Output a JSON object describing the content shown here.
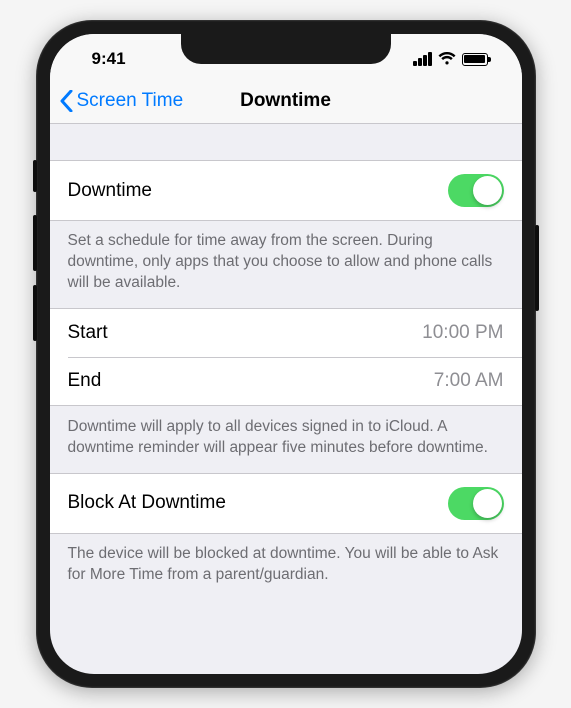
{
  "status": {
    "time": "9:41"
  },
  "nav": {
    "back_label": "Screen Time",
    "title": "Downtime"
  },
  "downtime_toggle": {
    "label": "Downtime",
    "on": true
  },
  "downtime_footer": "Set a schedule for time away from the screen. During downtime, only apps that you choose to allow and phone calls will be available.",
  "schedule": {
    "start_label": "Start",
    "start_value": "10:00 PM",
    "end_label": "End",
    "end_value": "7:00 AM"
  },
  "schedule_footer": "Downtime will apply to all devices signed in to iCloud. A downtime reminder will appear five minutes before downtime.",
  "block_toggle": {
    "label": "Block At Downtime",
    "on": true
  },
  "block_footer": "The device will be blocked at downtime. You will be able to Ask for More Time from a parent/guardian.",
  "colors": {
    "accent": "#007aff",
    "toggle_on": "#4cd964"
  }
}
